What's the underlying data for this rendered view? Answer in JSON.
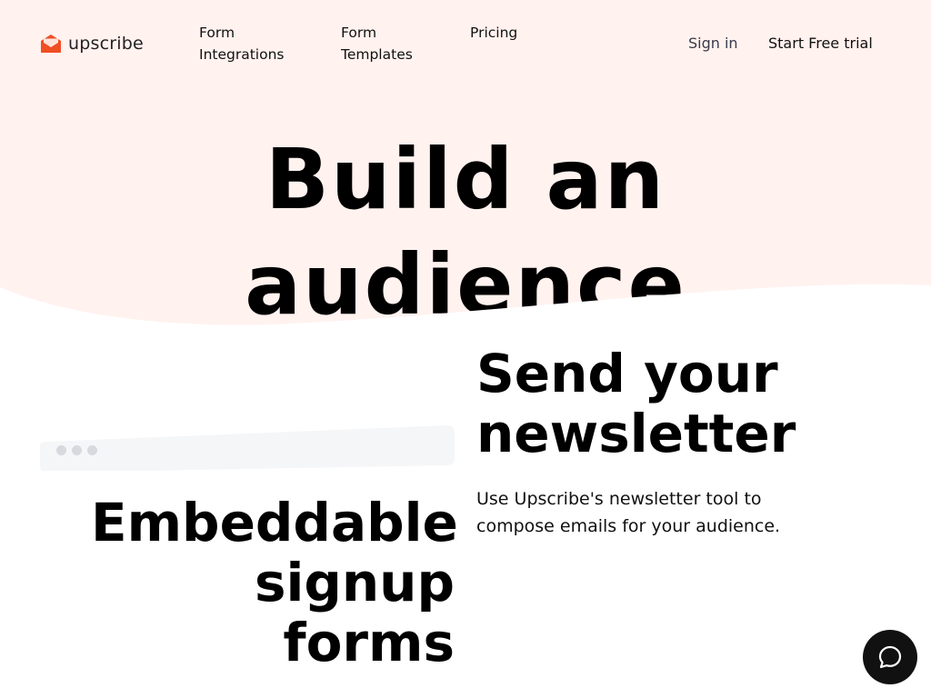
{
  "colors": {
    "hero_background": "#fff2ef",
    "brand": "#f04e23",
    "text": "#111111",
    "browser_bar": "#f5f6f8",
    "chat_button": "#111111"
  },
  "nav": {
    "brand": "upscribe",
    "brand_icon": "envelope-logo-icon",
    "links": [
      {
        "lines": [
          "Form",
          "Integrations"
        ]
      },
      {
        "lines": [
          "Form",
          "Templates"
        ]
      },
      {
        "lines": [
          "Pricing"
        ]
      }
    ],
    "sign_in": "Sign in",
    "start_trial": "Start Free trial"
  },
  "hero": {
    "title_lines": [
      "Build an",
      "audience"
    ]
  },
  "features": {
    "embed": {
      "title_lines": [
        "Embeddable",
        "signup",
        "forms"
      ],
      "browser_dots_icon": "window-dots-icon"
    },
    "newsletter": {
      "title_lines": [
        "Send your",
        "newsletter"
      ],
      "description": "Use Upscribe's newsletter tool to compose emails for your audience."
    }
  },
  "chat": {
    "icon": "chat-bubble-icon"
  }
}
